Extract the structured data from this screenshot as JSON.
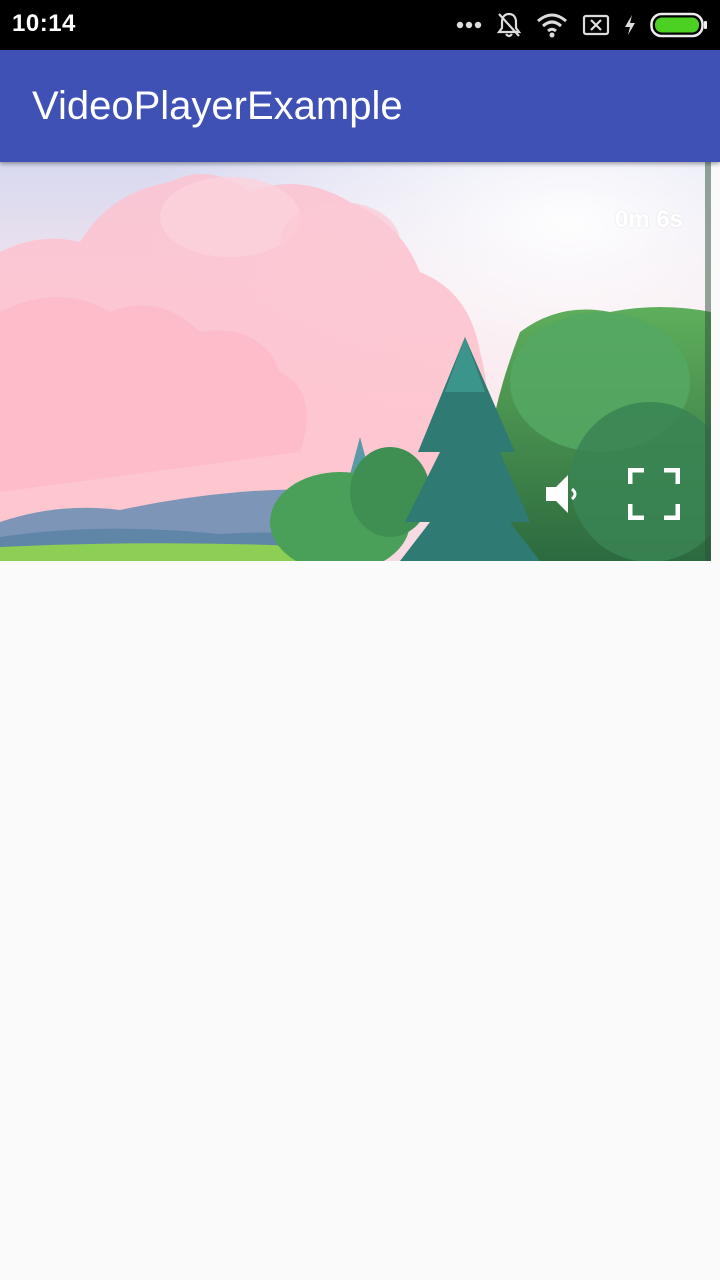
{
  "status_bar": {
    "time": "10:14",
    "icons": [
      "more-dots-icon",
      "notifications-off-icon",
      "wifi-icon",
      "no-sim-icon",
      "charging-bolt-icon",
      "battery-icon"
    ],
    "battery_color": "#4cd022"
  },
  "app_bar": {
    "title": "VideoPlayerExample",
    "color": "#3f51b5"
  },
  "video_player": {
    "time_label": "0m 6s",
    "controls": [
      "volume-icon",
      "fullscreen-icon"
    ]
  }
}
